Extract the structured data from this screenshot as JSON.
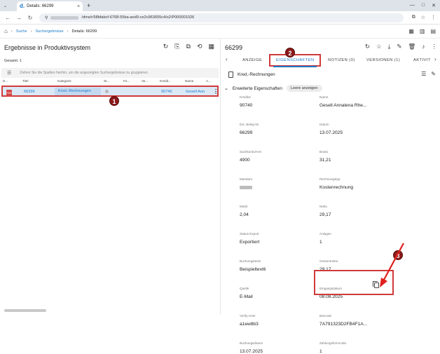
{
  "browser": {
    "tab_title": "Details: 66299",
    "tab_logo": "d.",
    "tab_close": "×",
    "new_tab": "+",
    "win_buttons": [
      "—",
      "□",
      "✕"
    ],
    "url": "/dms/r/58bfabcf-6768-55ba-aed9-ce2c963655c4/o2/P000001026",
    "nav": [
      "←",
      "→",
      "↻"
    ]
  },
  "breadcrumb": {
    "home_icon": "home-icon",
    "items": [
      "Suche",
      "Suchergebnisse",
      "Details: 66299"
    ]
  },
  "left": {
    "title": "Ergebnisse in Produktivsystem",
    "total": "Gesamt: 1",
    "group_hint": "Ziehen Sie die Spalten hierhin, um die angezeigten Suchergebnisse zu gruppieren.",
    "columns": [
      "D...",
      "Titel",
      "Kategorie",
      "St...",
      "Fo...",
      "Ve...",
      "Kredit...",
      "Name",
      "A..."
    ],
    "row": {
      "title": "66299",
      "category": "Kred.-Rechnungen",
      "kredit": "90740",
      "name": "Gesell Ann",
      "menu": "⋮"
    },
    "marker": "1"
  },
  "right": {
    "title": "66299",
    "tabs": [
      "ANZEIGE",
      "EIGENSCHAFTEN",
      "NOTIZEN (0)",
      "VERSIONEN (1)",
      "AKTIVIT"
    ],
    "marker2": "2",
    "marker3": "3",
    "doc_label": "Kred.-Rechnungen",
    "ext_label": "Erweiterte Eigenschaften",
    "chip": "Leere anzeigen",
    "fields": [
      {
        "l": "Kreditor",
        "v": "90740"
      },
      {
        "l": "Name",
        "v": "Gesell Annalena Rhe..."
      },
      {
        "l": "Ext. Beleg-Nr",
        "v": "66299"
      },
      {
        "l": "Datum",
        "v": "13.07.2025"
      },
      {
        "l": "Sachkonto/Arm",
        "v": "4900"
      },
      {
        "l": "Brutto",
        "v": "31,21"
      },
      {
        "l": "Mandant",
        "v": ""
      },
      {
        "l": "Rechnungstyp",
        "v": "Kostenrechnung"
      },
      {
        "l": "MwSt",
        "v": "2,04"
      },
      {
        "l": "Netto",
        "v": "29,17"
      },
      {
        "l": "Status Export",
        "v": "Exportiert"
      },
      {
        "l": "Anlagen",
        "v": "1"
      },
      {
        "l": "Buchungstexte",
        "v": "Beispieltext6"
      },
      {
        "l": "Gesamtnetto",
        "v": "29,17"
      },
      {
        "l": "Quelle",
        "v": "E-Mail"
      },
      {
        "l": "Eingangsdatum",
        "v": "08.08.2025"
      },
      {
        "l": "Verify-User",
        "v": "a1ew8b3"
      },
      {
        "l": "Barcode",
        "v": "7A791323D2FB4F1A..."
      },
      {
        "l": "Buchungsdatum",
        "v": "13.07.2025"
      },
      {
        "l": "Zahlungsformcode",
        "v": "1"
      }
    ]
  },
  "colors": {
    "accent": "#1f7ac9",
    "highlight": "#d03a3a",
    "marker": "#8b1a1a"
  }
}
